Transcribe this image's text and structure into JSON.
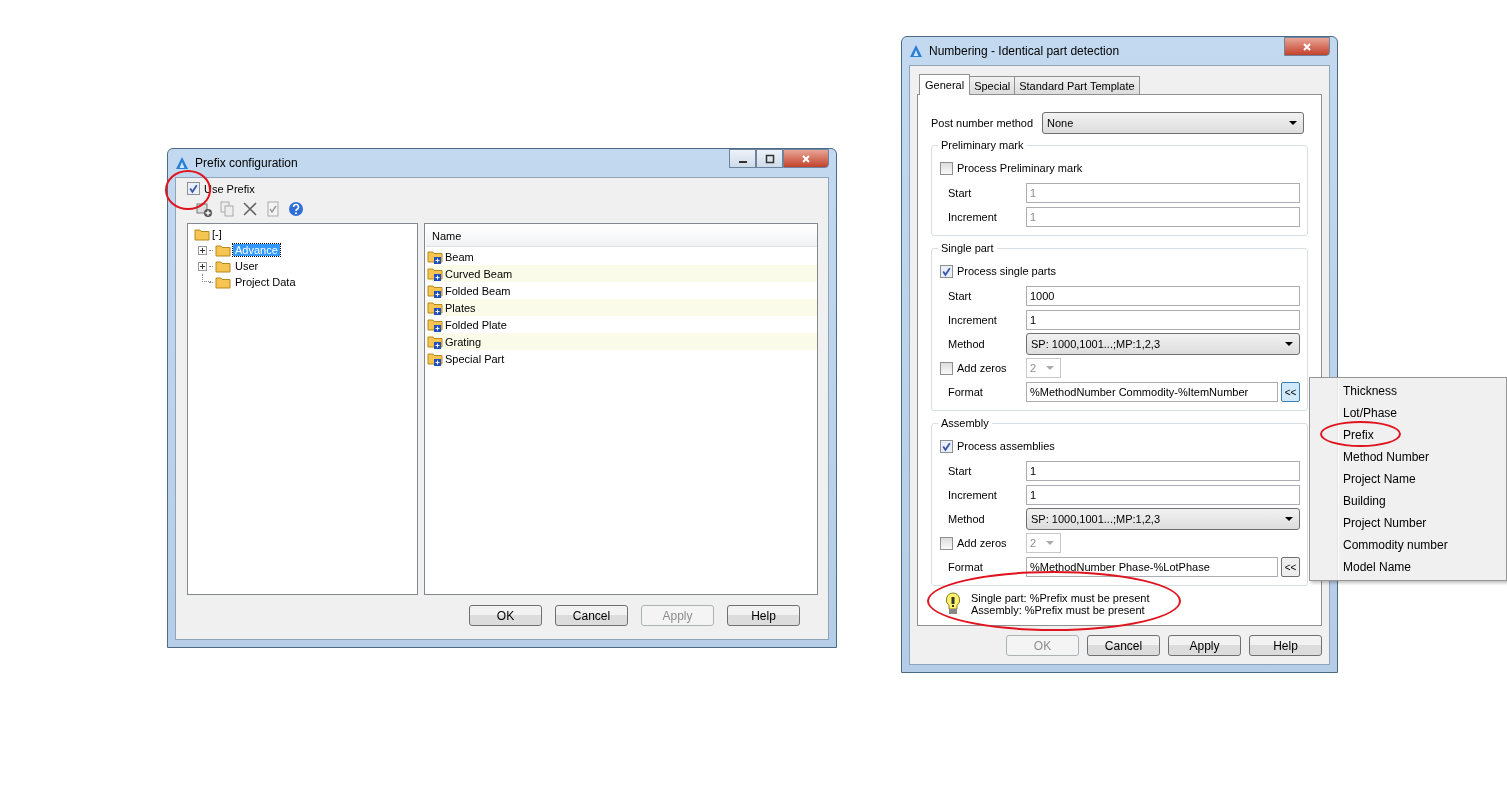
{
  "prefix_window": {
    "title": "Prefix configuration",
    "use_prefix": {
      "label": "Use Prefix",
      "checked": true
    },
    "tree": {
      "label": "[-]",
      "children": [
        {
          "label": "Advance",
          "expandable": true,
          "selected": true
        },
        {
          "label": "User",
          "expandable": true,
          "selected": false
        },
        {
          "label": "Project Data",
          "expandable": false,
          "selected": false
        }
      ]
    },
    "list": {
      "column": "Name",
      "items": [
        "Beam",
        "Curved Beam",
        "Folded Beam",
        "Plates",
        "Folded Plate",
        "Grating",
        "Special Part"
      ]
    },
    "buttons": [
      {
        "label": "OK",
        "disabled": false
      },
      {
        "label": "Cancel",
        "disabled": false
      },
      {
        "label": "Apply",
        "disabled": true
      },
      {
        "label": "Help",
        "disabled": false
      }
    ]
  },
  "numbering_window": {
    "title": "Numbering - Identical part detection",
    "tabs": [
      {
        "label": "General",
        "selected": true
      },
      {
        "label": "Special",
        "selected": false
      },
      {
        "label": "Standard Part Template",
        "selected": false
      }
    ],
    "post_number_method": {
      "label": "Post number method",
      "value": "None"
    },
    "groups": [
      {
        "title": "Preliminary mark",
        "process": {
          "label": "Process Preliminary mark",
          "checked": false
        },
        "rows": [
          {
            "kind": "text",
            "label": "Start",
            "value": "1",
            "disabled": true
          },
          {
            "kind": "text",
            "label": "Increment",
            "value": "1",
            "disabled": true
          }
        ]
      },
      {
        "title": "Single part",
        "process": {
          "label": "Process single parts",
          "checked": true
        },
        "rows": [
          {
            "kind": "text",
            "label": "Start",
            "value": "1000",
            "disabled": false
          },
          {
            "kind": "text",
            "label": "Increment",
            "value": "1",
            "disabled": false
          },
          {
            "kind": "select",
            "label": "Method",
            "value": "SP: 1000,1001...;MP:1,2,3"
          },
          {
            "kind": "zeros",
            "label": "Add zeros",
            "checked": false,
            "value": "2"
          },
          {
            "kind": "format",
            "label": "Format",
            "value": "%MethodNumber Commodity-%ItemNumber",
            "button": "<<",
            "button_active": true
          }
        ]
      },
      {
        "title": "Assembly",
        "process": {
          "label": "Process assemblies",
          "checked": true
        },
        "rows": [
          {
            "kind": "text",
            "label": "Start",
            "value": "1",
            "disabled": false
          },
          {
            "kind": "text",
            "label": "Increment",
            "value": "1",
            "disabled": false
          },
          {
            "kind": "select",
            "label": "Method",
            "value": "SP: 1000,1001...;MP:1,2,3"
          },
          {
            "kind": "zeros",
            "label": "Add zeros",
            "checked": false,
            "value": "2"
          },
          {
            "kind": "format",
            "label": "Format",
            "value": "%MethodNumber Phase-%LotPhase",
            "button": "<<",
            "button_active": false
          }
        ]
      }
    ],
    "hints": [
      "Single part: %Prefix must be present",
      "Assembly: %Prefix must be present"
    ],
    "buttons": [
      {
        "label": "OK",
        "disabled": true
      },
      {
        "label": "Cancel",
        "disabled": false
      },
      {
        "label": "Apply",
        "disabled": false
      },
      {
        "label": "Help",
        "disabled": false
      }
    ]
  },
  "context_menu": {
    "items": [
      "Thickness",
      "Lot/Phase",
      "Prefix",
      "Method Number",
      "Project Name",
      "Building",
      "Project Number",
      "Commodity number",
      "Model Name"
    ]
  }
}
